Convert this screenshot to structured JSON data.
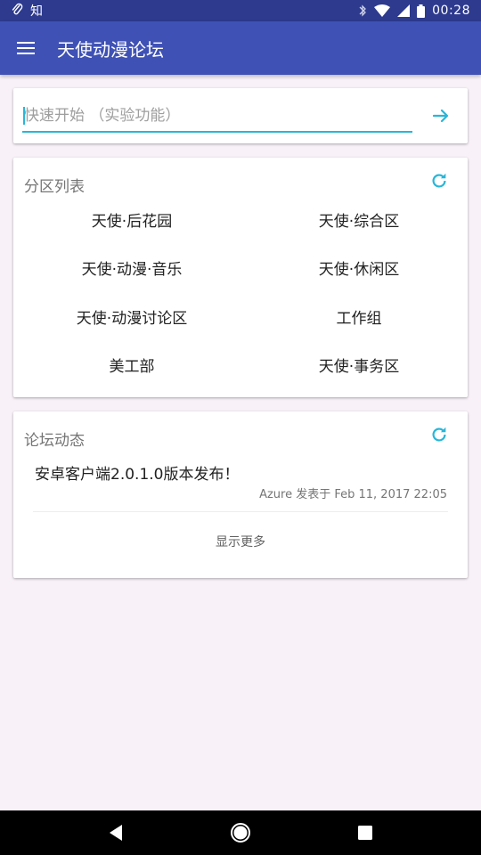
{
  "status_bar": {
    "left_icons": [
      "paperclip-icon",
      "zhi-app-icon"
    ],
    "zhi_glyph": "知",
    "right_icons": [
      "bluetooth-icon",
      "wifi-icon",
      "cell-signal-icon",
      "battery-icon"
    ],
    "time": "00:28"
  },
  "app_bar": {
    "menu_icon": "hamburger-menu-icon",
    "title": "天使动漫论坛",
    "color": "#3f51b5"
  },
  "quick_start": {
    "placeholder": "快速开始 （实验功能）",
    "value": "",
    "submit_icon": "arrow-right-icon",
    "accent_color": "#29b6d8"
  },
  "sections": {
    "header": "分区列表",
    "refresh_icon": "refresh-icon",
    "items": [
      [
        "天使·后花园",
        "天使·综合区"
      ],
      [
        "天使·动漫·音乐",
        "天使·休闲区"
      ],
      [
        "天使·动漫讨论区",
        "工作组"
      ],
      [
        "美工部",
        "天使·事务区"
      ]
    ]
  },
  "forum_news": {
    "header": "论坛动态",
    "refresh_icon": "refresh-icon",
    "posts": [
      {
        "title": "安卓客户端2.0.1.0版本发布！",
        "meta": "Azure 发表于 Feb 11, 2017 22:05"
      }
    ],
    "show_more": "显示更多"
  },
  "nav_bar": {
    "icons": [
      "back-icon",
      "home-icon",
      "recents-icon"
    ]
  }
}
